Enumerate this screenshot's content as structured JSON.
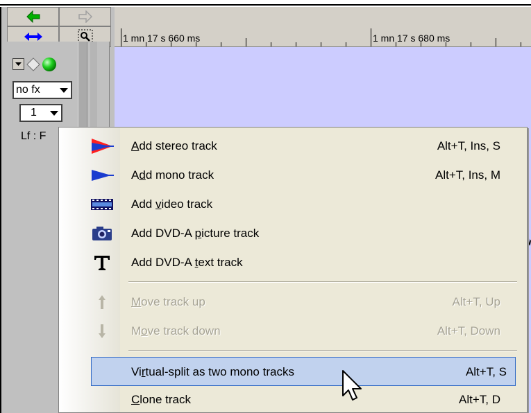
{
  "ruler": {
    "label_1": "1 mn 17 s 660 ms",
    "label_2": "1 mn 17 s 680 ms"
  },
  "track": {
    "fx_combo": "no fx",
    "channel_combo": "1",
    "channel_label": "Lf : F"
  },
  "menu": {
    "items": [
      {
        "label_pre": "",
        "accel": "A",
        "label_post": "dd stereo track",
        "shortcut": "Alt+T, Ins, S",
        "icon": "stereo-track-icon",
        "enabled": true
      },
      {
        "label_pre": "A",
        "accel": "d",
        "label_post": "d mono track",
        "shortcut": "Alt+T, Ins, M",
        "icon": "mono-track-icon",
        "enabled": true
      },
      {
        "label_pre": "Add ",
        "accel": "v",
        "label_post": "ideo track",
        "shortcut": "",
        "icon": "video-track-icon",
        "enabled": true
      },
      {
        "label_pre": "Add DVD-A ",
        "accel": "p",
        "label_post": "icture track",
        "shortcut": "",
        "icon": "camera-icon",
        "enabled": true
      },
      {
        "label_pre": "Add DVD-A ",
        "accel": "t",
        "label_post": "ext track",
        "shortcut": "",
        "icon": "text-track-icon",
        "enabled": true
      },
      {
        "label_pre": "",
        "accel": "M",
        "label_post": "ove track up",
        "shortcut": "Alt+T, Up",
        "icon": "arrow-up-icon",
        "enabled": false
      },
      {
        "label_pre": "M",
        "accel": "o",
        "label_post": "ve track down",
        "shortcut": "Alt+T, Down",
        "icon": "arrow-down-icon",
        "enabled": false
      },
      {
        "label_pre": "Vi",
        "accel": "r",
        "label_post": "tual-split as two mono tracks",
        "shortcut": "Alt+T, S",
        "icon": "",
        "enabled": true
      },
      {
        "label_pre": "",
        "accel": "C",
        "label_post": "lone track",
        "shortcut": "Alt+T, D",
        "icon": "",
        "enabled": true
      }
    ]
  },
  "colors": {
    "menu_bg": "#ece9d8",
    "highlight_bg": "#c1d2ee",
    "highlight_border": "#316ac5",
    "wave_bg": "#ccccff",
    "panel_bg": "#c0c0c0"
  }
}
